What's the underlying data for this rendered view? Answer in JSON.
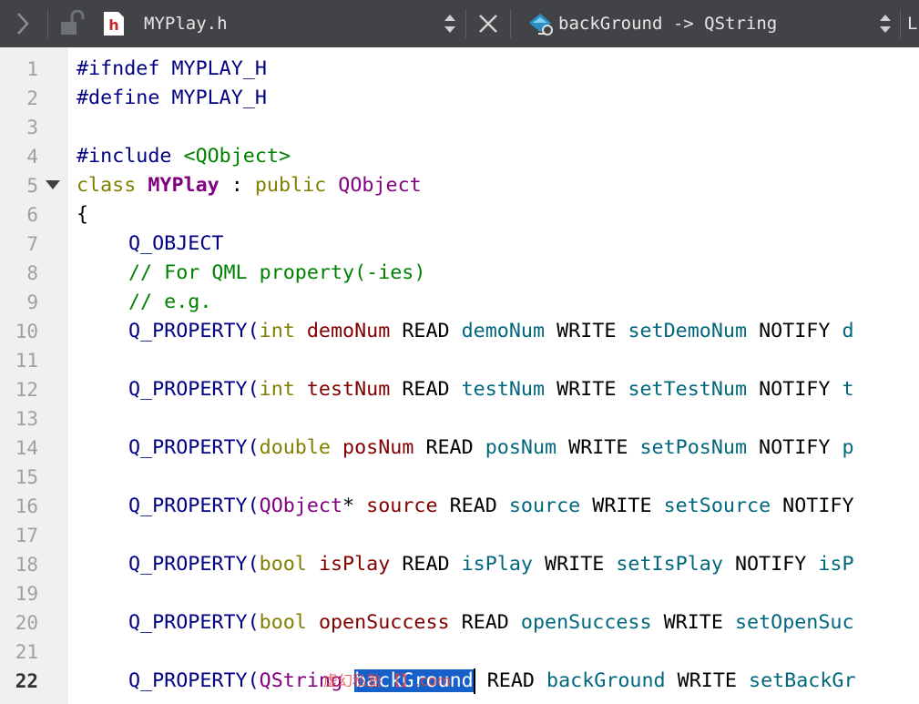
{
  "toolbar": {
    "file_name": "MYPlay.h",
    "symbol": "backGround -> QString",
    "right_cut": "L"
  },
  "colors": {
    "toolbar_bg": "#414346",
    "selection": "#1661c9",
    "keyword": "#808000",
    "type": "#800080",
    "member": "#800000",
    "accessor": "#00677c",
    "macro": "#000080",
    "comment": "#008000"
  },
  "editor": {
    "current_line": 22,
    "line_numbers": [
      "1",
      "2",
      "3",
      "4",
      "5",
      "6",
      "7",
      "8",
      "9",
      "10",
      "11",
      "12",
      "13",
      "14",
      "15",
      "16",
      "17",
      "18",
      "19",
      "20",
      "21",
      "22"
    ],
    "lines": {
      "l1": {
        "a": "#ifndef MYPLAY_H"
      },
      "l2": {
        "a": "#define MYPLAY_H"
      },
      "l4": {
        "a": "#include ",
        "b": "<QObject>"
      },
      "l5": {
        "a": "class",
        "b": " ",
        "c": "MYPlay",
        "d": " : ",
        "e": "public",
        "f": " ",
        "g": "QObject"
      },
      "l6": {
        "a": "{"
      },
      "l7": {
        "a": "Q_OBJECT"
      },
      "l8": {
        "a": "// For QML property(-ies)"
      },
      "l9": {
        "a": "// e.g."
      },
      "l10": {
        "a": "Q_PROPERTY(",
        "b": "int",
        "c": " ",
        "d": "demoNum",
        "e": " READ ",
        "f": "demoNum",
        "g": " WRITE ",
        "h": "setDemoNum",
        "i": " NOTIFY ",
        "j": "d"
      },
      "l12": {
        "a": "Q_PROPERTY(",
        "b": "int",
        "c": " ",
        "d": "testNum",
        "e": " READ ",
        "f": "testNum",
        "g": " WRITE ",
        "h": "setTestNum",
        "i": " NOTIFY ",
        "j": "t"
      },
      "l14": {
        "a": "Q_PROPERTY(",
        "b": "double",
        "c": " ",
        "d": "posNum",
        "e": " READ ",
        "f": "posNum",
        "g": " WRITE ",
        "h": "setPosNum",
        "i": " NOTIFY ",
        "j": "p"
      },
      "l16": {
        "a": "Q_PROPERTY(",
        "b": "QObject",
        "c": "* ",
        "d": "source",
        "e": " READ ",
        "f": "source",
        "g": " WRITE ",
        "h": "setSource",
        "i": " NOTIFY"
      },
      "l18": {
        "a": "Q_PROPERTY(",
        "b": "bool",
        "c": " ",
        "d": "isPlay",
        "e": " READ ",
        "f": "isPlay",
        "g": " WRITE ",
        "h": "setIsPlay",
        "i": " NOTIFY ",
        "j": "isP"
      },
      "l20": {
        "a": "Q_PROPERTY(",
        "b": "bool",
        "c": " ",
        "d": "openSuccess",
        "e": " READ ",
        "f": "openSuccess",
        "g": " WRITE ",
        "h": "setOpenSuc"
      },
      "l22": {
        "a": "Q_PROPERTY(",
        "b": "QString",
        "c": " ",
        "d": "backGround",
        "e": " READ ",
        "f": "backGround",
        "g": " WRITE ",
        "h": "setBackGr"
      }
    }
  },
  "watermark": "虚幻私塾 【】.com"
}
